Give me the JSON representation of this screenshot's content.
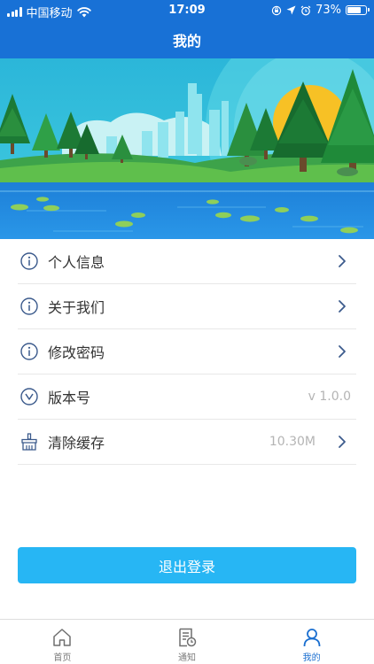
{
  "status_bar": {
    "carrier": "中国移动",
    "time": "17:09",
    "battery": "73%",
    "battery_level": 0.73
  },
  "header": {
    "title": "我的"
  },
  "menu": {
    "items": [
      {
        "label": "个人信息",
        "icon": "info-circle-icon",
        "value": "",
        "has_arrow": true
      },
      {
        "label": "关于我们",
        "icon": "info-circle-icon",
        "value": "",
        "has_arrow": true
      },
      {
        "label": "修改密码",
        "icon": "info-circle-icon",
        "value": "",
        "has_arrow": true
      },
      {
        "label": "版本号",
        "icon": "chevron-down-circle-icon",
        "value": "v 1.0.0",
        "has_arrow": false
      },
      {
        "label": "清除缓存",
        "icon": "broom-icon",
        "value": "10.30M",
        "has_arrow": true
      }
    ]
  },
  "logout": {
    "label": "退出登录"
  },
  "tabbar": {
    "tabs": [
      {
        "label": "首页",
        "icon": "home-icon",
        "active": false
      },
      {
        "label": "通知",
        "icon": "notice-doc-icon",
        "active": false
      },
      {
        "label": "我的",
        "icon": "user-icon",
        "active": true
      }
    ]
  },
  "colors": {
    "header": "#1871d6",
    "accent": "#27b6f4",
    "active_tab": "#1b6fd0"
  }
}
